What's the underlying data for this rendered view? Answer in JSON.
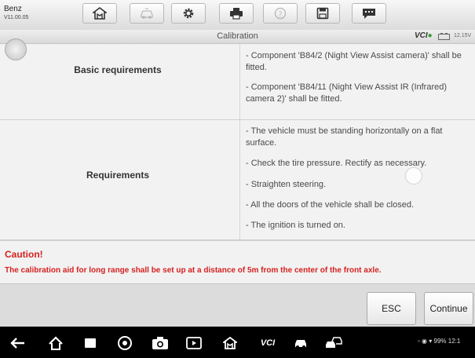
{
  "app": {
    "name": "Benz",
    "version": "V11.00.05"
  },
  "toolbar": [
    {
      "icon": "home-icon",
      "enabled": true
    },
    {
      "icon": "vehicle-swap-icon",
      "enabled": false
    },
    {
      "icon": "gear-icon",
      "enabled": true
    },
    {
      "icon": "printer-icon",
      "enabled": true
    },
    {
      "icon": "help-icon",
      "enabled": false
    },
    {
      "icon": "save-icon",
      "enabled": true
    },
    {
      "icon": "message-icon",
      "enabled": true
    }
  ],
  "header": {
    "title": "Calibration",
    "vci_logo": "VCI",
    "voltage": "12.15V"
  },
  "table": {
    "rows": [
      {
        "label": "Basic requirements",
        "items": [
          "- Component 'B84/2 (Night View Assist camera)' shall be fitted.",
          "- Component 'B84/11 (Night View Assist IR (Infrared) camera 2)' shall be fitted."
        ]
      },
      {
        "label": "Requirements",
        "items": [
          "- The vehicle must be standing horizontally on a flat surface.",
          "- Check the tire pressure. Rectify as necessary.",
          "- Straighten steering.",
          "- All the doors of the vehicle shall be closed.",
          "- The ignition is turned on."
        ]
      }
    ]
  },
  "caution": {
    "title": "Caution!",
    "text": "The calibration aid for long range shall be set up at a distance of 5m from the center of the front axle."
  },
  "buttons": {
    "esc": "ESC",
    "continue": "Continue"
  },
  "navbar": {
    "vcl_label": "VCI",
    "status": "99% 12:1"
  },
  "colors": {
    "caution": "#d62020",
    "vci_green": "#3a9a35"
  }
}
